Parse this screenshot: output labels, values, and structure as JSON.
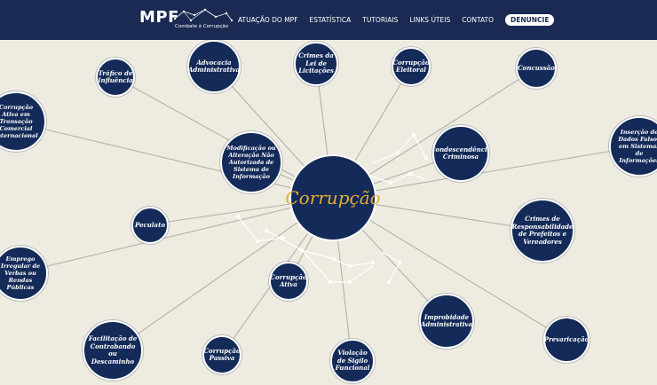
{
  "header": {
    "logo": "MPF",
    "logo_subtitle": "Combate à Corrupção",
    "nav": [
      "ATUAÇÃO DO MPF",
      "ESTATÍSTICA",
      "TUTORIAIS",
      "LINKS ÚTEIS",
      "CONTATO"
    ],
    "cta": "DENUNCIE"
  },
  "colors": {
    "header": "#1a2a52",
    "node": "#142a58",
    "accent": "#e3ad32",
    "background": "#eeebe1"
  },
  "map": {
    "center": "Corrupção",
    "nodes": [
      "Tráfico de Influência",
      "Advocacia Administrativa",
      "Crimes da Lei de Licitações",
      "Corrupção Eleitoral",
      "Concussão",
      "Corrupção Ativa em Transação Comercial Internacional",
      "Modificação ou Alteração Não Autorizada de Sistema de Informação",
      "Condescendência Criminosa",
      "Inserção de Dados Falsos em Sistemas de Informações",
      "Peculato",
      "Crimes de Responsabilidade de Prefeitos e Vereadores",
      "Emprego Irregular de Verbas ou Rendas Públicas",
      "Corrupção Ativa",
      "Improbidade Administrativa",
      "Prevaricação",
      "Facilitação de Contrabando ou Descaminho",
      "Corrupção Passiva",
      "Violação de Sigilo Funcional"
    ]
  }
}
